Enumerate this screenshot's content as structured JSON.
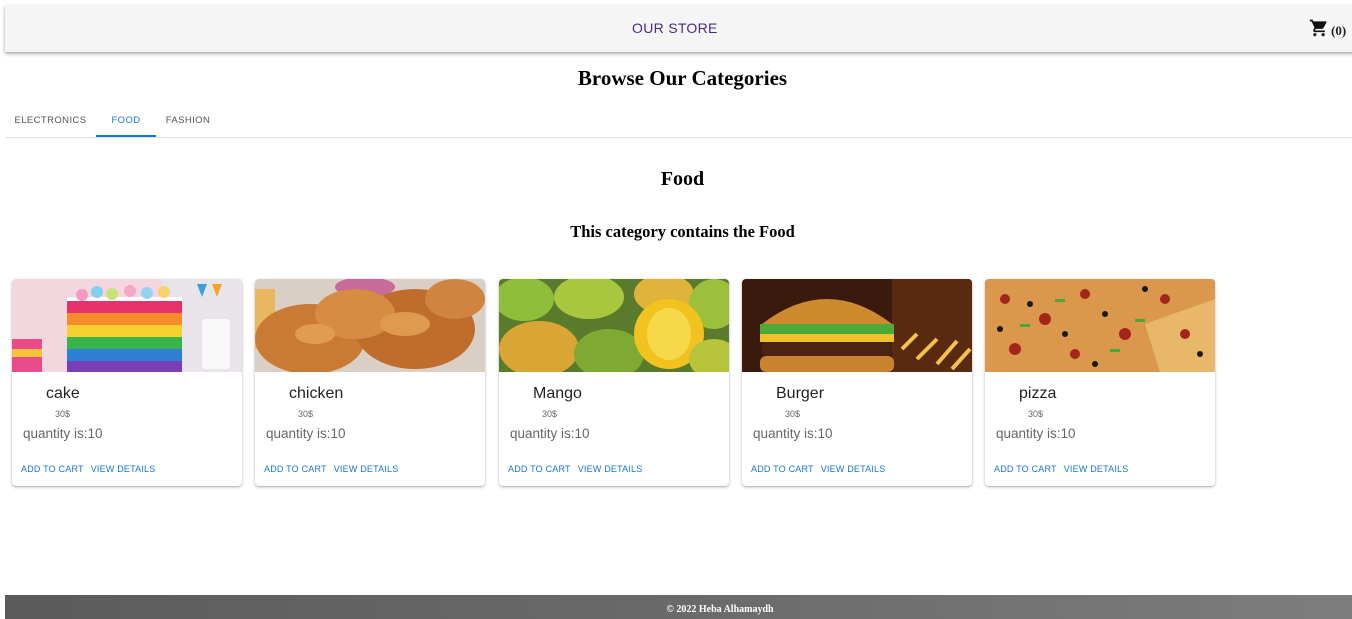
{
  "header": {
    "store_title": "OUR STORE",
    "cart_count": "(0)",
    "cart_icon": "shopping-cart-icon"
  },
  "page_heading": "Browse Our Categories",
  "tabs": [
    {
      "label": "ELECTRONICS",
      "active": false
    },
    {
      "label": "FOOD",
      "active": true
    },
    {
      "label": "FASHION",
      "active": false
    }
  ],
  "category": {
    "title": "Food",
    "description": "This category contains the Food"
  },
  "products": [
    {
      "name": "cake",
      "price": "30$",
      "quantity": "quantity is:10",
      "add_label": "ADD TO CART",
      "details_label": "VIEW DETAILS"
    },
    {
      "name": "chicken",
      "price": "30$",
      "quantity": "quantity is:10",
      "add_label": "ADD TO CART",
      "details_label": "VIEW DETAILS"
    },
    {
      "name": "Mango",
      "price": "30$",
      "quantity": "quantity is:10",
      "add_label": "ADD TO CART",
      "details_label": "VIEW DETAILS"
    },
    {
      "name": "Burger",
      "price": "30$",
      "quantity": "quantity is:10",
      "add_label": "ADD TO CART",
      "details_label": "VIEW DETAILS"
    },
    {
      "name": "pizza",
      "price": "30$",
      "quantity": "quantity is:10",
      "add_label": "ADD TO CART",
      "details_label": "VIEW DETAILS"
    }
  ],
  "footer": {
    "text": "© 2022 Heba Alhamaydh"
  },
  "colors": {
    "accent": "#1976d2",
    "store_title": "#4b2a82",
    "appbar": "#f5f5f5",
    "footer": "#666666"
  }
}
